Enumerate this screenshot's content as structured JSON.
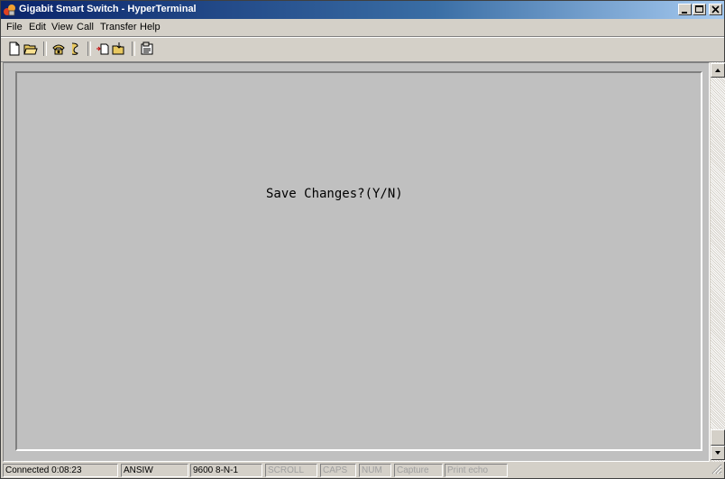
{
  "window": {
    "title": "Gigabit Smart Switch - HyperTerminal"
  },
  "menu": [
    "File",
    "Edit",
    "View",
    "Call",
    "Transfer",
    "Help"
  ],
  "toolbar": [
    "new-connection-icon",
    "open-icon",
    "connect-icon",
    "disconnect-icon",
    "send-icon",
    "receive-icon",
    "properties-icon"
  ],
  "terminal": {
    "text": "Save Changes?(Y/N)"
  },
  "status": {
    "connected": "Connected 0:08:23",
    "emulation": "ANSIW",
    "port": "9600 8-N-1",
    "scroll": "SCROLL",
    "caps": "CAPS",
    "num": "NUM",
    "capture": "Capture",
    "print_echo": "Print echo"
  }
}
